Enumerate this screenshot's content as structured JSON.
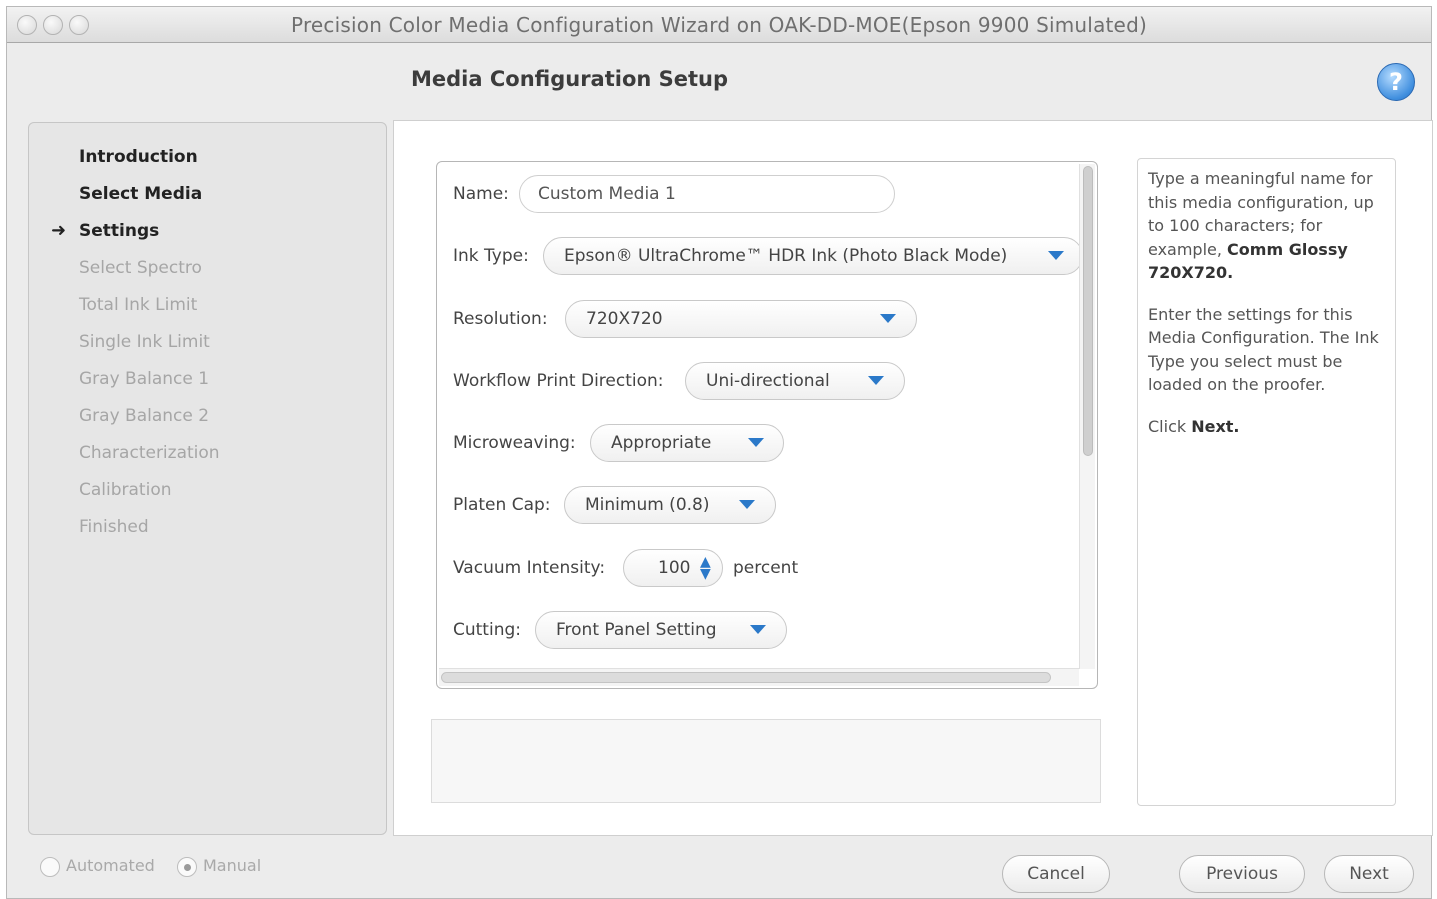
{
  "window": {
    "title": "Precision Color Media Configuration Wizard on OAK-DD-MOE(Epson 9900 Simulated)"
  },
  "header": {
    "title": "Media Configuration Setup",
    "help_icon": "help-icon",
    "help_glyph": "?"
  },
  "sidebar": {
    "current_marker": "➜",
    "steps": [
      {
        "label": "Introduction",
        "state": "done"
      },
      {
        "label": "Select Media",
        "state": "done"
      },
      {
        "label": "Settings",
        "state": "current"
      },
      {
        "label": "Select Spectro",
        "state": "future"
      },
      {
        "label": "Total Ink Limit",
        "state": "future"
      },
      {
        "label": "Single Ink Limit",
        "state": "future"
      },
      {
        "label": "Gray Balance 1",
        "state": "future"
      },
      {
        "label": "Gray Balance 2",
        "state": "future"
      },
      {
        "label": "Characterization",
        "state": "future"
      },
      {
        "label": "Calibration",
        "state": "future"
      },
      {
        "label": "Finished",
        "state": "future"
      }
    ]
  },
  "form": {
    "name": {
      "label": "Name:",
      "value": "Custom Media 1"
    },
    "ink_type": {
      "label": "Ink Type:",
      "value": "Epson® UltraChrome™ HDR Ink (Photo Black Mode)"
    },
    "resolution": {
      "label": "Resolution:",
      "value": "720X720"
    },
    "workflow_print_direction": {
      "label": "Workflow Print Direction:",
      "value": "Uni-directional"
    },
    "microweaving": {
      "label": "Microweaving:",
      "value": "Appropriate"
    },
    "platen_cap": {
      "label": "Platen Cap:",
      "value": "Minimum (0.8)"
    },
    "vacuum_intensity": {
      "label": "Vacuum Intensity:",
      "value": "100",
      "unit": "percent"
    },
    "cutting": {
      "label": "Cutting:",
      "value": "Front Panel Setting"
    }
  },
  "help_text": {
    "p1_a": "Type a meaningful name for this media configuration, up to 100 characters; for example,",
    "p1_b": "Comm Glossy 720X720.",
    "p2": "Enter the settings for this Media Configuration. The Ink Type you select must be loaded on the proofer.",
    "p3_a": "Click",
    "p3_b": "Next."
  },
  "footer": {
    "automated_label": "Automated",
    "manual_label": "Manual",
    "mode_selected": "Manual",
    "cancel_label": "Cancel",
    "previous_label": "Previous",
    "next_label": "Next"
  },
  "colors": {
    "accent": "#2b79c9",
    "help_icon": "#3f8ede"
  }
}
